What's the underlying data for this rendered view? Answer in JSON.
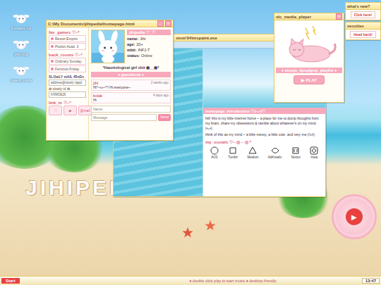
{
  "desktop_icons": [
    {
      "label": "essays.sy"
    },
    {
      "label": "jihi.log"
    },
    {
      "label": "sleep.state"
    }
  ],
  "watermark": "JIHIPEDIA",
  "homepage_window": {
    "title": "C:\\My Documents\\jihipedia\\homepage.html",
    "controls": [
      "_",
      "×"
    ],
    "fav_games": {
      "header": "fav_games ♡~*",
      "items": [
        "Resort Empire",
        "Pocket Acad. 3"
      ]
    },
    "back_rooms": {
      "header": "back_rooms ♡~*",
      "items": [
        "Ordinary Sunday",
        "Feminist Friday"
      ]
    },
    "slowly": {
      "header": "SLOwLY mAIL fRnDs",
      "field": "address@slowly (app)",
      "id_label": "✿ slowly id ✿",
      "id_value": "KXMOE26"
    },
    "link_in": {
      "header": "link_in ♡~*",
      "buttons": [
        "♡",
        "▶",
        "@mail"
      ]
    },
    "profile": {
      "tag": "jihipedia ♡_♡",
      "fields": [
        {
          "label": "name:",
          "value": "Jihi"
        },
        {
          "label": "age:",
          "value": "20+"
        },
        {
          "label": "mbti:",
          "value": "INFJ-T"
        },
        {
          "label": "status:",
          "value": "Online"
        }
      ],
      "quote": "*Hauntological girl shit ◉__◉*"
    },
    "guestbook": {
      "header": "♦ guestbook ♦",
      "entries": [
        {
          "name": "jihi",
          "time": "2 weeks ago",
          "message": "Hi^~ω~^!! Hi everyone~"
        },
        {
          "name": "kolab",
          "time": "4 days ago",
          "message": "Hi"
        }
      ],
      "name_placeholder": "Name",
      "message_placeholder": "Message",
      "send": "Send"
    }
  },
  "paint_window": {
    "title": "stom'04\\mspaint.exe",
    "intro": {
      "header": "homepage_introduction ♡(•ᴗ•)♡",
      "paragraphs": [
        "hiii! this is my little internet home ~ a place for me to dump thoughts from my brain, share my obsessions & ramble about whatever's on my mind (•ᴗ•)",
        "think of this as my mind ~ a little messy, a little cute, and very me (/ω\\)"
      ]
    },
    "socials": {
      "header": "my_socials ♡~ ◎ ~ ◎ *",
      "items": [
        {
          "label": "AO3"
        },
        {
          "label": "Tumblr"
        },
        {
          "label": "Medium"
        },
        {
          "label": "AdKreativ"
        },
        {
          "label": "Notion"
        },
        {
          "label": "Insta"
        }
      ]
    }
  },
  "vlc_window": {
    "title": "vlc_media_player",
    "controls": [
      "×"
    ],
    "playlist": "♦ shoujo_kpop/jpop_playlist ♦",
    "play": "▶ PLAY"
  },
  "whats_new": {
    "title": "what's new?",
    "button": "Click here!"
  },
  "neocities": {
    "title": "neocities",
    "button": "Head back!"
  },
  "music_disc": {
    "play": "▶"
  },
  "taskbar": {
    "start": "Start",
    "hint": "♦ double click play to start music ♦ desktop friendly",
    "clock": "13:47"
  }
}
